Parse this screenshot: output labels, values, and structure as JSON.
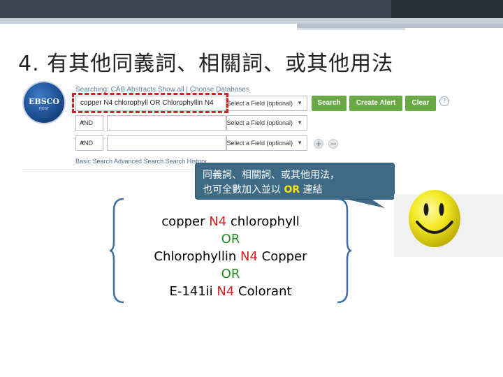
{
  "title": "4. 有其他同義詞、相關詞、或其他用法",
  "ebsco": {
    "logo_text": "EBSCO",
    "logo_sub": "HOST",
    "searching_line": "Searching: CAB Abstracts  Show all  |  Choose Databases",
    "rows": [
      {
        "bool": "",
        "query": "copper N4 chlorophyll OR Chlorophyllin N4",
        "field": "Select a Field (optional)"
      },
      {
        "bool": "AND",
        "query": "",
        "field": "Select a Field (optional)"
      },
      {
        "bool": "AND",
        "query": "",
        "field": "Select a Field (optional)"
      }
    ],
    "buttons": {
      "search": "Search",
      "create_alert": "Create Alert",
      "clear": "Clear"
    },
    "help": "?",
    "add": "+",
    "remove": "−",
    "links": "Basic Search    Advanced Search    Search History"
  },
  "callout": {
    "line1": "同義詞、相關詞、或其他用法，",
    "line2_prefix": "也可全數加入並以 ",
    "line2_keyword": "OR",
    "line2_suffix": " 連結"
  },
  "query": {
    "line1": {
      "a": "copper ",
      "op": "N4",
      "b": " chlorophyll"
    },
    "or1": "OR",
    "line2": {
      "a": "Chlorophyllin ",
      "op": "N4",
      "b": " Copper"
    },
    "or2": "OR",
    "line3": {
      "a": "E-141ii ",
      "op": "N4",
      "b": " Colorant"
    }
  },
  "colors": {
    "accent_red": "#d42020",
    "or_green": "#238b23",
    "button_green": "#6aa945",
    "callout_bg": "#3d6b86",
    "brace_blue": "#3a6fa8"
  }
}
